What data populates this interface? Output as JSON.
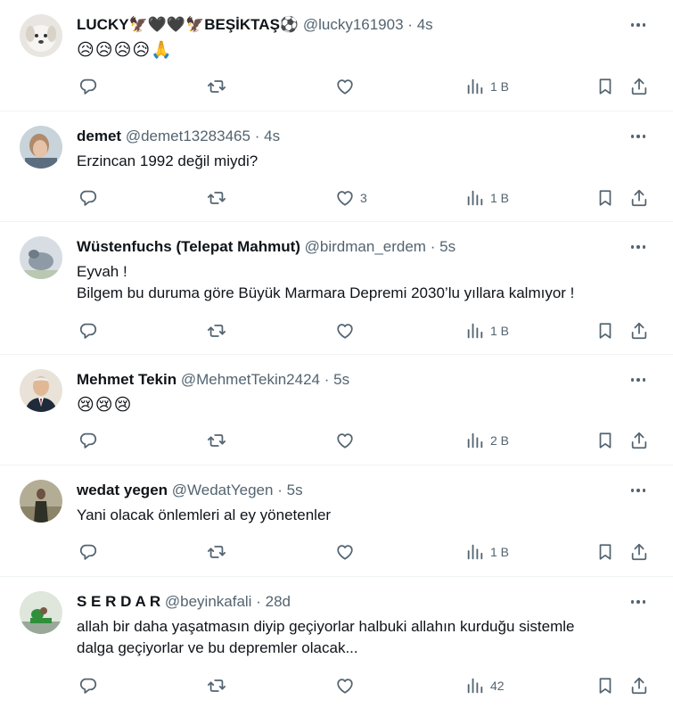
{
  "tweets": [
    {
      "name": "LUCKY🦅🖤🖤🦅BEŞİKTAŞ⚽",
      "handle": "@lucky161903",
      "sep": "·",
      "time": "4s",
      "text": "",
      "emoji": "😥😥😥😥🙏",
      "replies": "",
      "retweets": "",
      "likes": "",
      "views": "1 B",
      "avatar": "avatar-lucky"
    },
    {
      "name": "demet",
      "handle": "@demet13283465",
      "sep": "·",
      "time": "4s",
      "text": "Erzincan 1992 değil miydi?",
      "emoji": "",
      "replies": "",
      "retweets": "",
      "likes": "3",
      "views": "1 B",
      "avatar": "avatar-demet"
    },
    {
      "name": "Wüstenfuchs (Telepat Mahmut)",
      "handle": "@birdman_erdem",
      "sep": "·",
      "time": "5s",
      "text": "Eyvah !",
      "text2": "Bilgem bu duruma göre Büyük Marmara Depremi 2030’lu yıllara kalmıyor !",
      "emoji": "",
      "replies": "",
      "retweets": "",
      "likes": "",
      "views": "1 B",
      "avatar": "avatar-wustenfuchs"
    },
    {
      "name": "Mehmet Tekin",
      "handle": "@MehmetTekin2424",
      "sep": "·",
      "time": "5s",
      "text": "",
      "emoji": "😢😢😢",
      "replies": "",
      "retweets": "",
      "likes": "",
      "views": "2 B",
      "avatar": "avatar-mehmet"
    },
    {
      "name": "wedat yegen",
      "handle": "@WedatYegen",
      "sep": "·",
      "time": "5s",
      "text": "Yani olacak önlemleri al ey yönetenler",
      "emoji": "",
      "replies": "",
      "retweets": "",
      "likes": "",
      "views": "1 B",
      "avatar": "avatar-wedat"
    },
    {
      "name": "S E R D A R",
      "handle": "@beyinkafali",
      "sep": "·",
      "time": "28d",
      "text": "allah bir daha yaşatmasın diyip geçiyorlar halbuki allahın kurduğu sistemle",
      "text2": "dalga geçiyorlar ve bu depremler olacak...",
      "emoji": "",
      "replies": "",
      "retweets": "",
      "likes": "",
      "views": "42",
      "avatar": "avatar-serdar"
    }
  ],
  "colors": {
    "text": "#0f1419",
    "muted": "#536471",
    "border": "#eff3f4"
  },
  "icons": [
    "reply-icon",
    "retweet-icon",
    "like-icon",
    "views-icon",
    "bookmark-icon",
    "share-icon",
    "more-icon"
  ]
}
